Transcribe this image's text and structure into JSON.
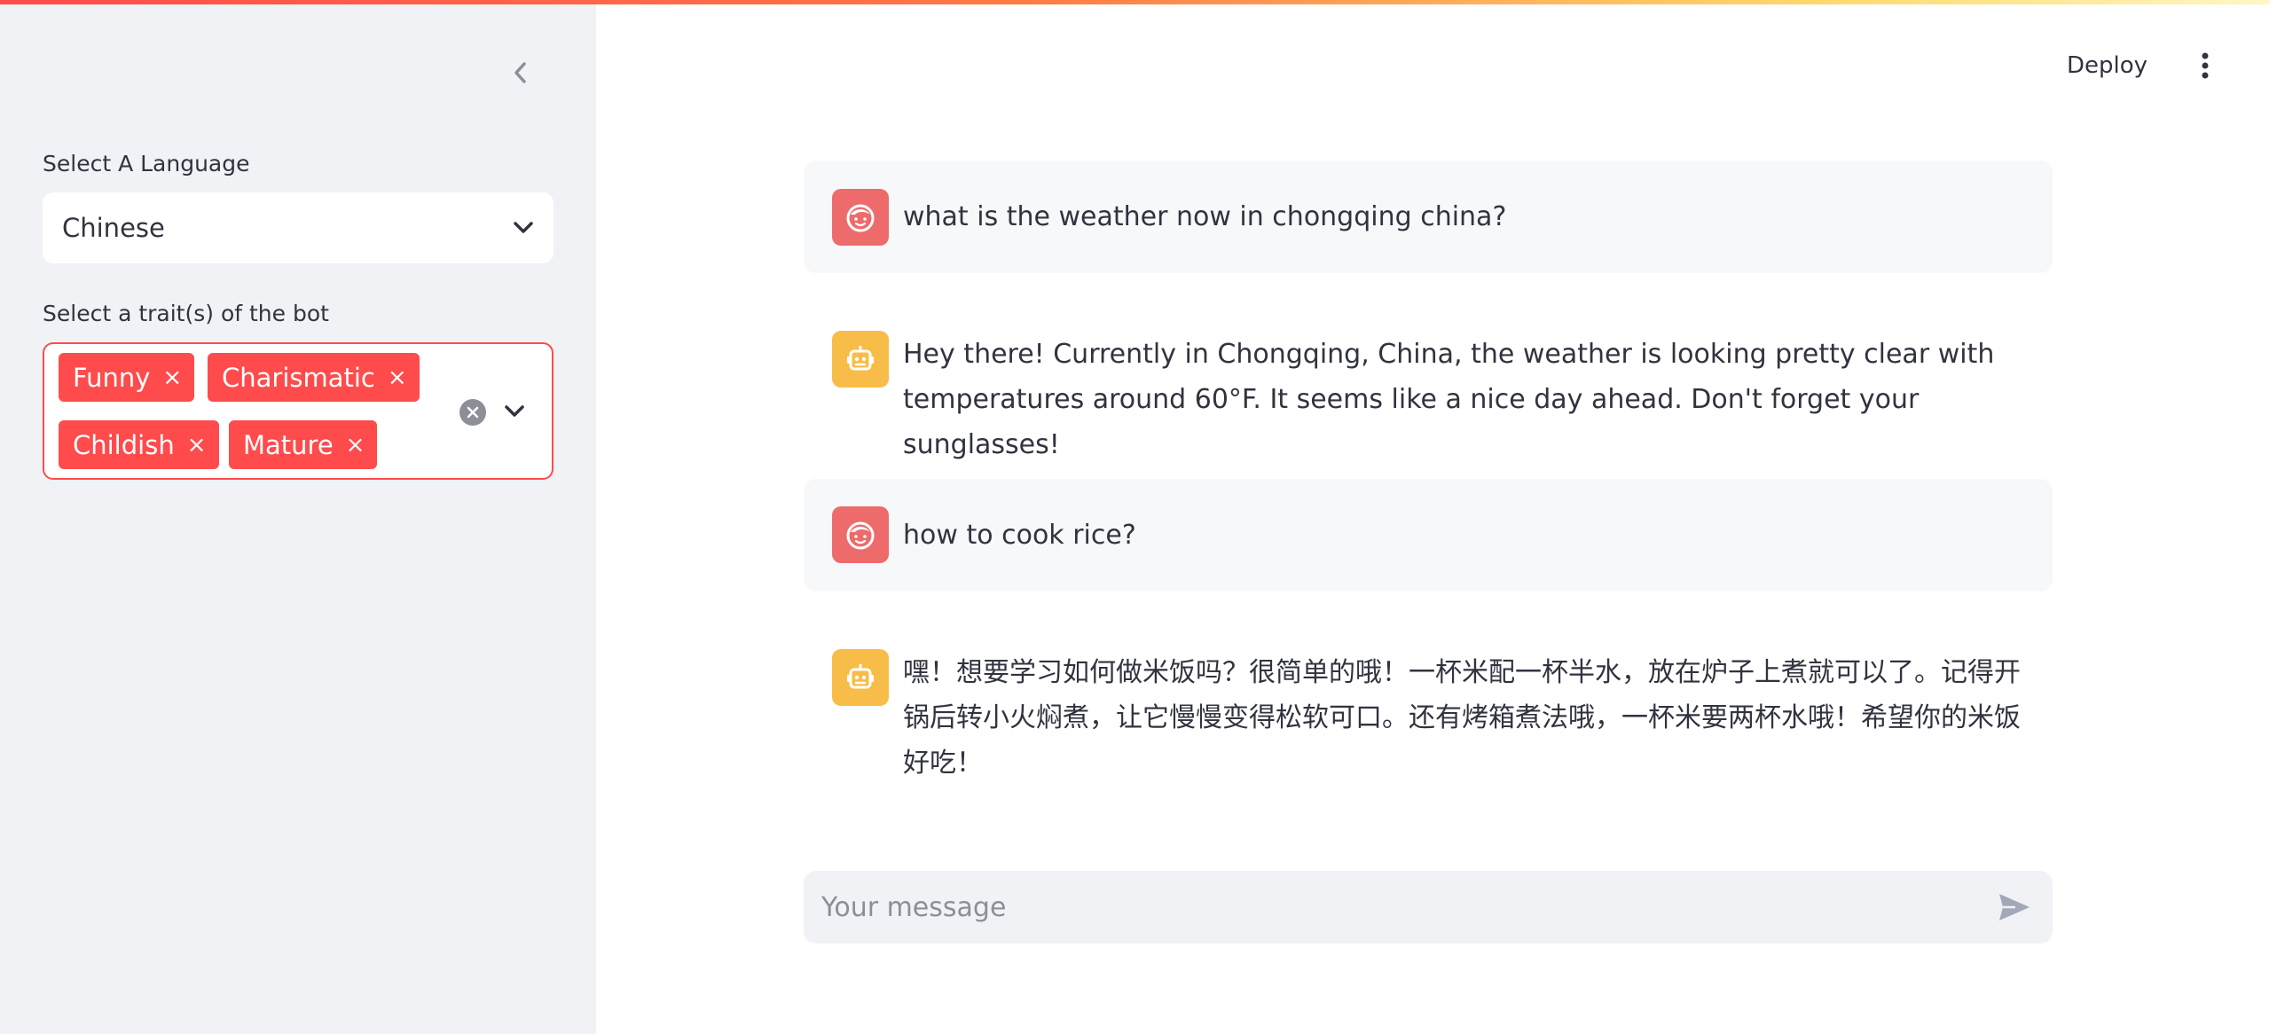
{
  "header": {
    "deploy_label": "Deploy",
    "menu_icon": "more-vertical-icon"
  },
  "sidebar": {
    "collapse_icon": "chevron-left-icon",
    "language": {
      "label": "Select A Language",
      "selected": "Chinese"
    },
    "traits": {
      "label": "Select a trait(s) of the bot",
      "selected": [
        "Funny",
        "Charismatic",
        "Childish",
        "Mature"
      ],
      "remove_glyph": "×"
    }
  },
  "chat": {
    "messages": [
      {
        "role": "user",
        "avatar_icon": "user-face-icon",
        "text": "what is the weather now in chongqing china?"
      },
      {
        "role": "assistant",
        "avatar_icon": "robot-icon",
        "text": "Hey there! Currently in Chongqing, China, the weather is looking pretty clear with temperatures around 60°F. It seems like a nice day ahead. Don't forget your sunglasses!"
      },
      {
        "role": "user",
        "avatar_icon": "user-face-icon",
        "text": "how to cook rice?"
      },
      {
        "role": "assistant",
        "avatar_icon": "robot-icon",
        "text": "嘿！想要学习如何做米饭吗？很简单的哦！一杯米配一杯半水，放在炉子上煮就可以了。记得开锅后转小火焖煮，让它慢慢变得松软可口。还有烤箱煮法哦，一杯米要两杯水哦！希望你的米饭好吃！"
      }
    ],
    "input": {
      "placeholder": "Your message",
      "value": "",
      "send_icon": "send-icon"
    }
  },
  "colors": {
    "primary": "#ff4b4b",
    "sidebar_bg": "#f0f2f6",
    "user_avatar": "#ee6b6b",
    "bot_avatar": "#f8bd49",
    "text": "#31333f"
  }
}
